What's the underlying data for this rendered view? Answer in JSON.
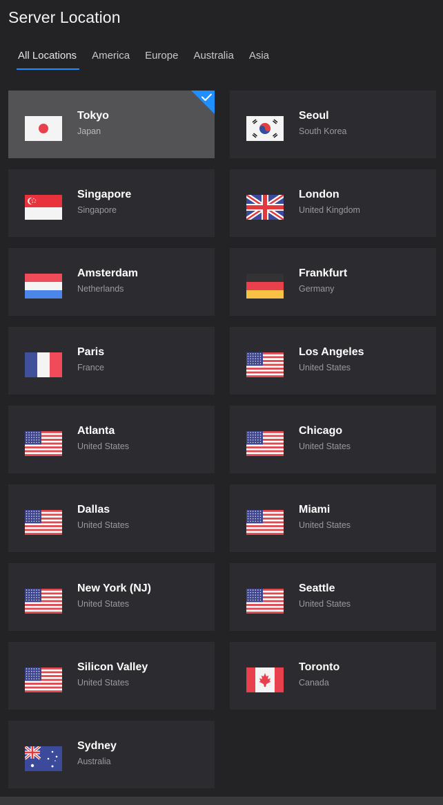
{
  "page_title": "Server Location",
  "tabs": [
    {
      "label": "All Locations",
      "active": true
    },
    {
      "label": "America",
      "active": false
    },
    {
      "label": "Europe",
      "active": false
    },
    {
      "label": "Australia",
      "active": false
    },
    {
      "label": "Asia",
      "active": false
    }
  ],
  "locations": [
    {
      "city": "Tokyo",
      "country": "Japan",
      "flag": "japan-flag-icon",
      "selected": true
    },
    {
      "city": "Seoul",
      "country": "South Korea",
      "flag": "south-korea-flag-icon",
      "selected": false
    },
    {
      "city": "Singapore",
      "country": "Singapore",
      "flag": "singapore-flag-icon",
      "selected": false
    },
    {
      "city": "London",
      "country": "United Kingdom",
      "flag": "uk-flag-icon",
      "selected": false
    },
    {
      "city": "Amsterdam",
      "country": "Netherlands",
      "flag": "netherlands-flag-icon",
      "selected": false
    },
    {
      "city": "Frankfurt",
      "country": "Germany",
      "flag": "germany-flag-icon",
      "selected": false
    },
    {
      "city": "Paris",
      "country": "France",
      "flag": "france-flag-icon",
      "selected": false
    },
    {
      "city": "Los Angeles",
      "country": "United States",
      "flag": "usa-flag-icon",
      "selected": false
    },
    {
      "city": "Atlanta",
      "country": "United States",
      "flag": "usa-flag-icon",
      "selected": false
    },
    {
      "city": "Chicago",
      "country": "United States",
      "flag": "usa-flag-icon",
      "selected": false
    },
    {
      "city": "Dallas",
      "country": "United States",
      "flag": "usa-flag-icon",
      "selected": false
    },
    {
      "city": "Miami",
      "country": "United States",
      "flag": "usa-flag-icon",
      "selected": false
    },
    {
      "city": "New York (NJ)",
      "country": "United States",
      "flag": "usa-flag-icon",
      "selected": false
    },
    {
      "city": "Seattle",
      "country": "United States",
      "flag": "usa-flag-icon",
      "selected": false
    },
    {
      "city": "Silicon Valley",
      "country": "United States",
      "flag": "usa-flag-icon",
      "selected": false
    },
    {
      "city": "Toronto",
      "country": "Canada",
      "flag": "canada-flag-icon",
      "selected": false
    },
    {
      "city": "Sydney",
      "country": "Australia",
      "flag": "australia-flag-icon",
      "selected": false
    }
  ],
  "colors": {
    "background": "#232326",
    "card": "#2c2c30",
    "card_selected": "#535355",
    "accent": "#1f8fff"
  }
}
